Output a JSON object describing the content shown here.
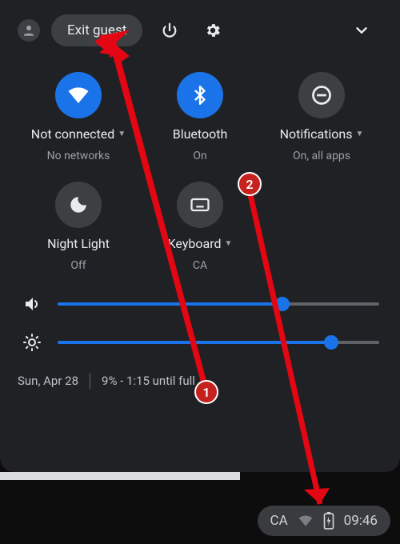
{
  "header": {
    "exit_label": "Exit guest"
  },
  "toggles": {
    "wifi": {
      "title": "Not connected",
      "sub": "No networks",
      "has_caret": true,
      "on": true
    },
    "bt": {
      "title": "Bluetooth",
      "sub": "On",
      "has_caret": false,
      "on": true
    },
    "notif": {
      "title": "Notifications",
      "sub": "On, all apps",
      "has_caret": true,
      "on": false
    },
    "night": {
      "title": "Night Light",
      "sub": "Off",
      "has_caret": false,
      "on": false
    },
    "keyboard": {
      "title": "Keyboard",
      "sub": "CA",
      "has_caret": true,
      "on": false
    }
  },
  "sliders": {
    "volume": {
      "value": 70
    },
    "brightness": {
      "value": 85
    }
  },
  "status": {
    "date": "Sun, Apr 28",
    "battery": "9% - 1:15 until full"
  },
  "tray": {
    "ime": "CA",
    "time": "09:46"
  },
  "annotations": {
    "badge1": "1",
    "badge2": "2"
  }
}
